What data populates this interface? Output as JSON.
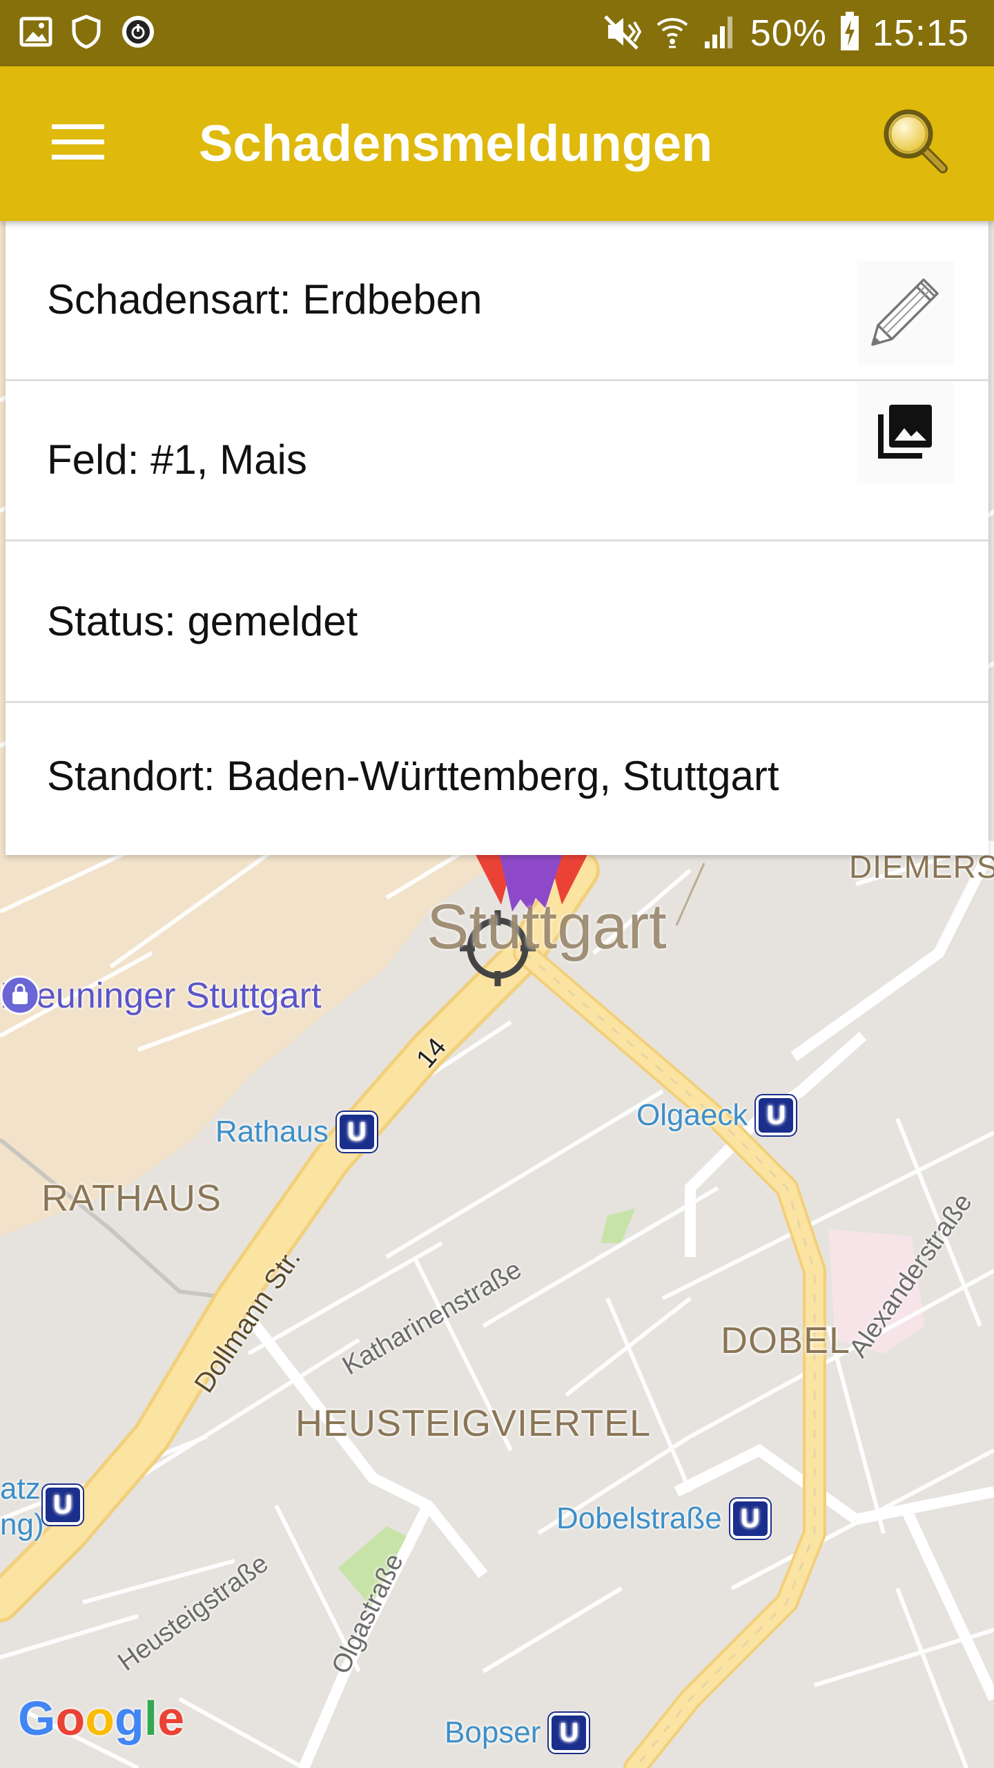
{
  "status_bar": {
    "battery": "50%",
    "time": "15:15",
    "colors": {
      "background": "#86700b"
    }
  },
  "toolbar": {
    "title": "Schadensmeldungen",
    "colors": {
      "background": "#dfb90c",
      "title": "#ffffff"
    },
    "icons": {
      "menu": "hamburger-menu-icon",
      "search": "magnifier-icon"
    }
  },
  "card": {
    "damage_type": "Schadensart: Erdbeben",
    "field": "Feld: #1, Mais",
    "status": "Status: gemeldet",
    "location": "Standort: Baden-Württemberg, Stuttgart",
    "icons": {
      "edit": "pencil-icon",
      "photos": "photo-library-icon"
    }
  },
  "map": {
    "city_label": "Stuttgart",
    "districts": {
      "rathaus": "RATHAUS",
      "dobel": "DOBEL",
      "heusteigviertel": "HEUSTEIGVIERTEL",
      "diemers": "DIEMERS"
    },
    "places": {
      "breuninger": "Breuninger Stuttgart"
    },
    "stations": {
      "rathaus": "Rathaus",
      "olgaeck": "Olgaeck",
      "dobelstrasse": "Dobelstraße",
      "bopser": "Bopser",
      "partial_a": "atz",
      "partial_b": "ng)"
    },
    "ubahn_symbol": "U",
    "streets": {
      "route": "14",
      "dollmann": "Dollmann Str.",
      "katharinen": "Katharinenstraße",
      "alexander": "Alexanderstraße",
      "heusteig": "Heusteigstraße",
      "olga": "Olgastraße"
    },
    "google": {
      "G": "G",
      "o1": "o",
      "o2": "o",
      "g": "g",
      "l": "l",
      "e": "e"
    },
    "colors": {
      "urban": "#f1e2c9",
      "base": "#e6e3de",
      "road": "#fbe3a1",
      "road_edge": "#f2cf7a",
      "park": "#c8e3a8",
      "marker_red": "#ea4335",
      "marker_purple": "#8e49c9",
      "ubahn": "#1a2e8c"
    }
  }
}
